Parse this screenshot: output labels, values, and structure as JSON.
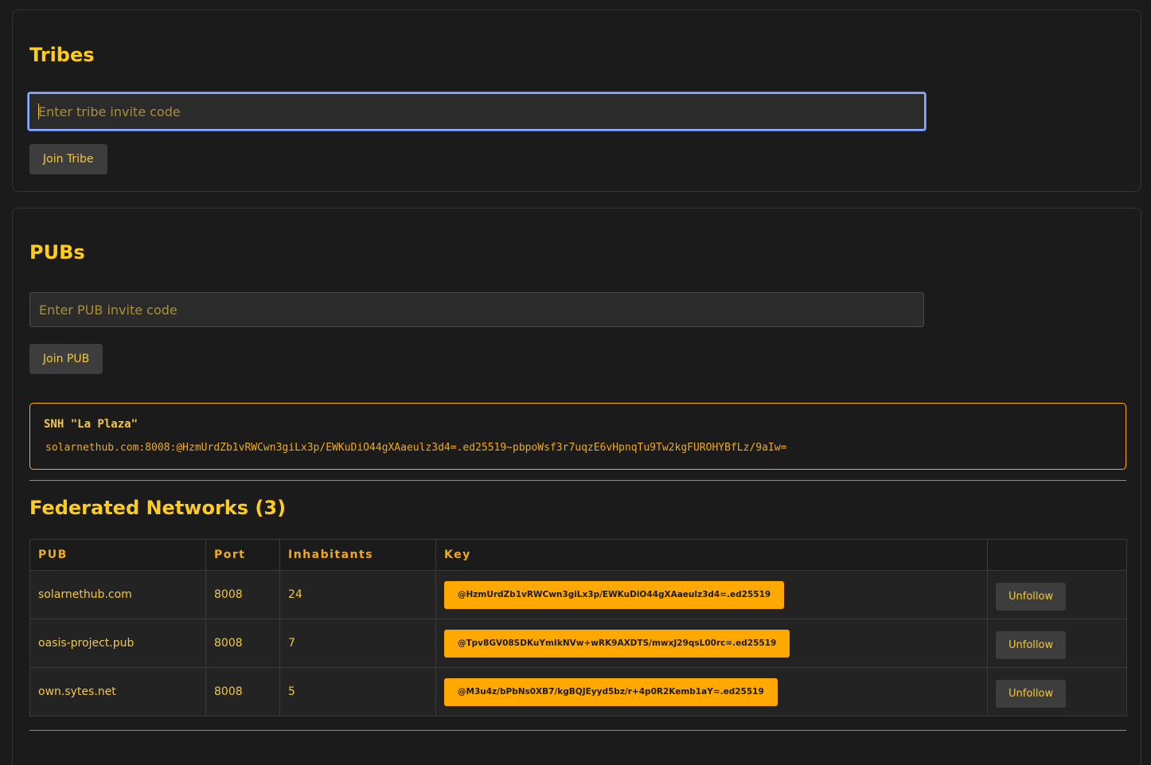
{
  "tribes": {
    "title": "Tribes",
    "input_placeholder": "Enter tribe invite code",
    "join_label": "Join Tribe"
  },
  "pubs": {
    "title": "PUBs",
    "input_placeholder": "Enter PUB invite code",
    "join_label": "Join PUB",
    "featured": {
      "name": "SNH \"La Plaza\"",
      "code": "solarnethub.com:8008:@HzmUrdZb1vRWCwn3giLx3p/EWKuDiO44gXAaeulz3d4=.ed25519~pbpoWsf3r7uqzE6vHpnqTu9Tw2kgFUROHYBfLz/9aIw="
    }
  },
  "federated": {
    "title": "Federated Networks (3)",
    "columns": [
      "PUB",
      "Port",
      "Inhabitants",
      "Key",
      ""
    ],
    "rows": [
      {
        "pub": "solarnethub.com",
        "port": "8008",
        "inhabitants": "24",
        "key": "@HzmUrdZb1vRWCwn3giLx3p/EWKuDiO44gXAaeulz3d4=.ed25519",
        "action": "Unfollow"
      },
      {
        "pub": "oasis-project.pub",
        "port": "8008",
        "inhabitants": "7",
        "key": "@Tpv8GV08SDKuYmIkNVw+wRK9AXDTS/mwxJ29qsL00rc=.ed25519",
        "action": "Unfollow"
      },
      {
        "pub": "own.sytes.net",
        "port": "8008",
        "inhabitants": "5",
        "key": "@M3u4z/bPbNs0XB7/kgBQJEyyd5bz/r+4p0R2Kemb1aY=.ed25519",
        "action": "Unfollow"
      }
    ]
  },
  "colors": {
    "background": "#1b1b1b",
    "heading": "#ffcc1a",
    "accent": "#ffa800",
    "focus_ring": "#8fb0ff"
  }
}
